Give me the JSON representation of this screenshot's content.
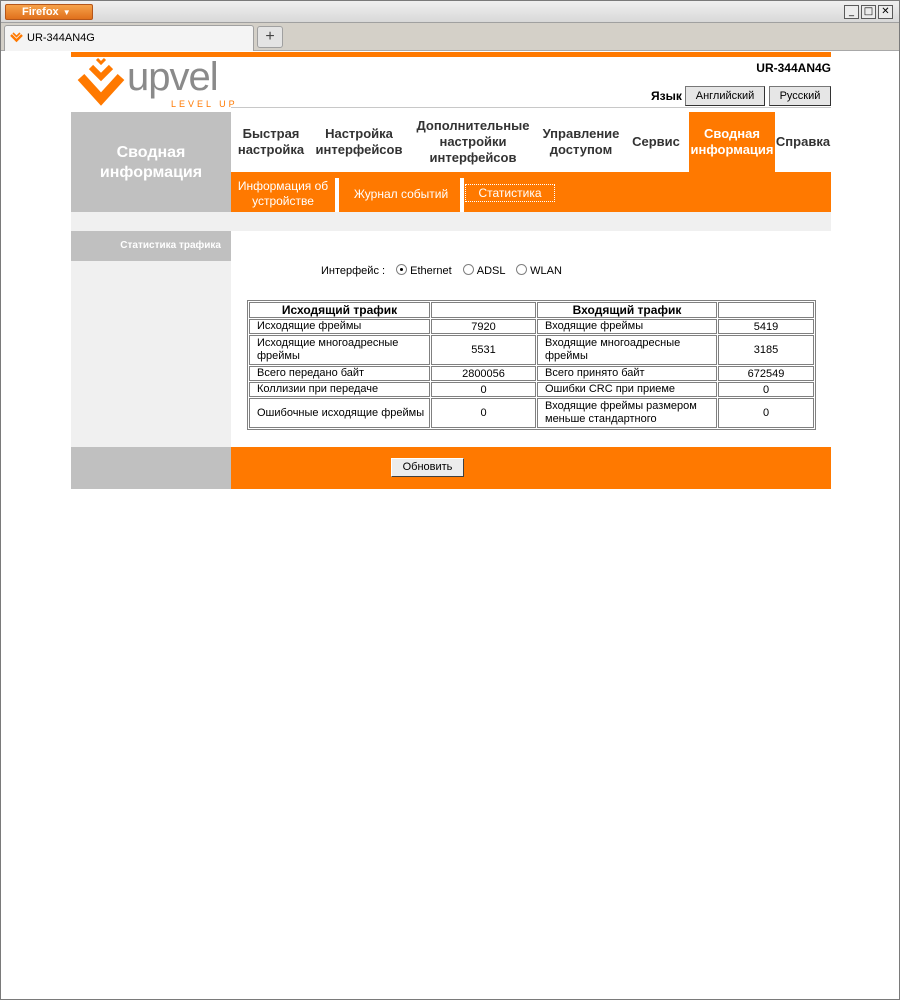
{
  "browser": {
    "menu_label": "Firefox",
    "tab_title": "UR-344AN4G",
    "new_tab": "+",
    "controls": {
      "minimize": "_",
      "maximize": "□",
      "close": "✕"
    }
  },
  "header": {
    "model": "UR-344AN4G",
    "logo_text": "upvel",
    "logo_tagline": "LEVEL UP",
    "lang_label": "Язык",
    "lang_en": "Английский",
    "lang_ru": "Русский"
  },
  "nav": {
    "section_title": "Сводная информация",
    "items": [
      {
        "label": "Быстрая настройка"
      },
      {
        "label": "Настройка интерфейсов"
      },
      {
        "label": "Дополнительные настройки интерфейсов"
      },
      {
        "label": "Управление доступом"
      },
      {
        "label": "Сервис"
      },
      {
        "label": "Сводная информация"
      },
      {
        "label": "Справка"
      }
    ],
    "active_index": 5
  },
  "subnav": {
    "items": [
      {
        "label": "Информация об устройстве"
      },
      {
        "label": "Журнал событий"
      },
      {
        "label": "Статистика"
      }
    ],
    "active_index": 2
  },
  "sidebar": {
    "title": "Статистика трафика"
  },
  "interface": {
    "label": "Интерфейс :",
    "options": [
      "Ethernet",
      "ADSL",
      "WLAN"
    ],
    "selected": "Ethernet"
  },
  "stats": {
    "tx_header": "Исходящий трафик",
    "rx_header": "Входящий трафик",
    "rows": [
      {
        "tx_label": "Исходящие фреймы",
        "tx_value": "7920",
        "rx_label": "Входящие фреймы",
        "rx_value": "5419"
      },
      {
        "tx_label": "Исходящие многоадресные фреймы",
        "tx_value": "5531",
        "rx_label": "Входящие многоадресные фреймы",
        "rx_value": "3185"
      },
      {
        "tx_label": "Всего передано байт",
        "tx_value": "2800056",
        "rx_label": "Всего принято байт",
        "rx_value": "672549"
      },
      {
        "tx_label": "Коллизии при передаче",
        "tx_value": "0",
        "rx_label": "Ошибки CRC при приеме",
        "rx_value": "0"
      },
      {
        "tx_label": "Ошибочные исходящие фреймы",
        "tx_value": "0",
        "rx_label": "Входящие фреймы размером меньше стандартного",
        "rx_value": "0"
      }
    ]
  },
  "footer": {
    "refresh_label": "Обновить"
  },
  "colors": {
    "accent": "#ff7900",
    "gray": "#c0c0c0",
    "light": "#f0f0f0"
  }
}
